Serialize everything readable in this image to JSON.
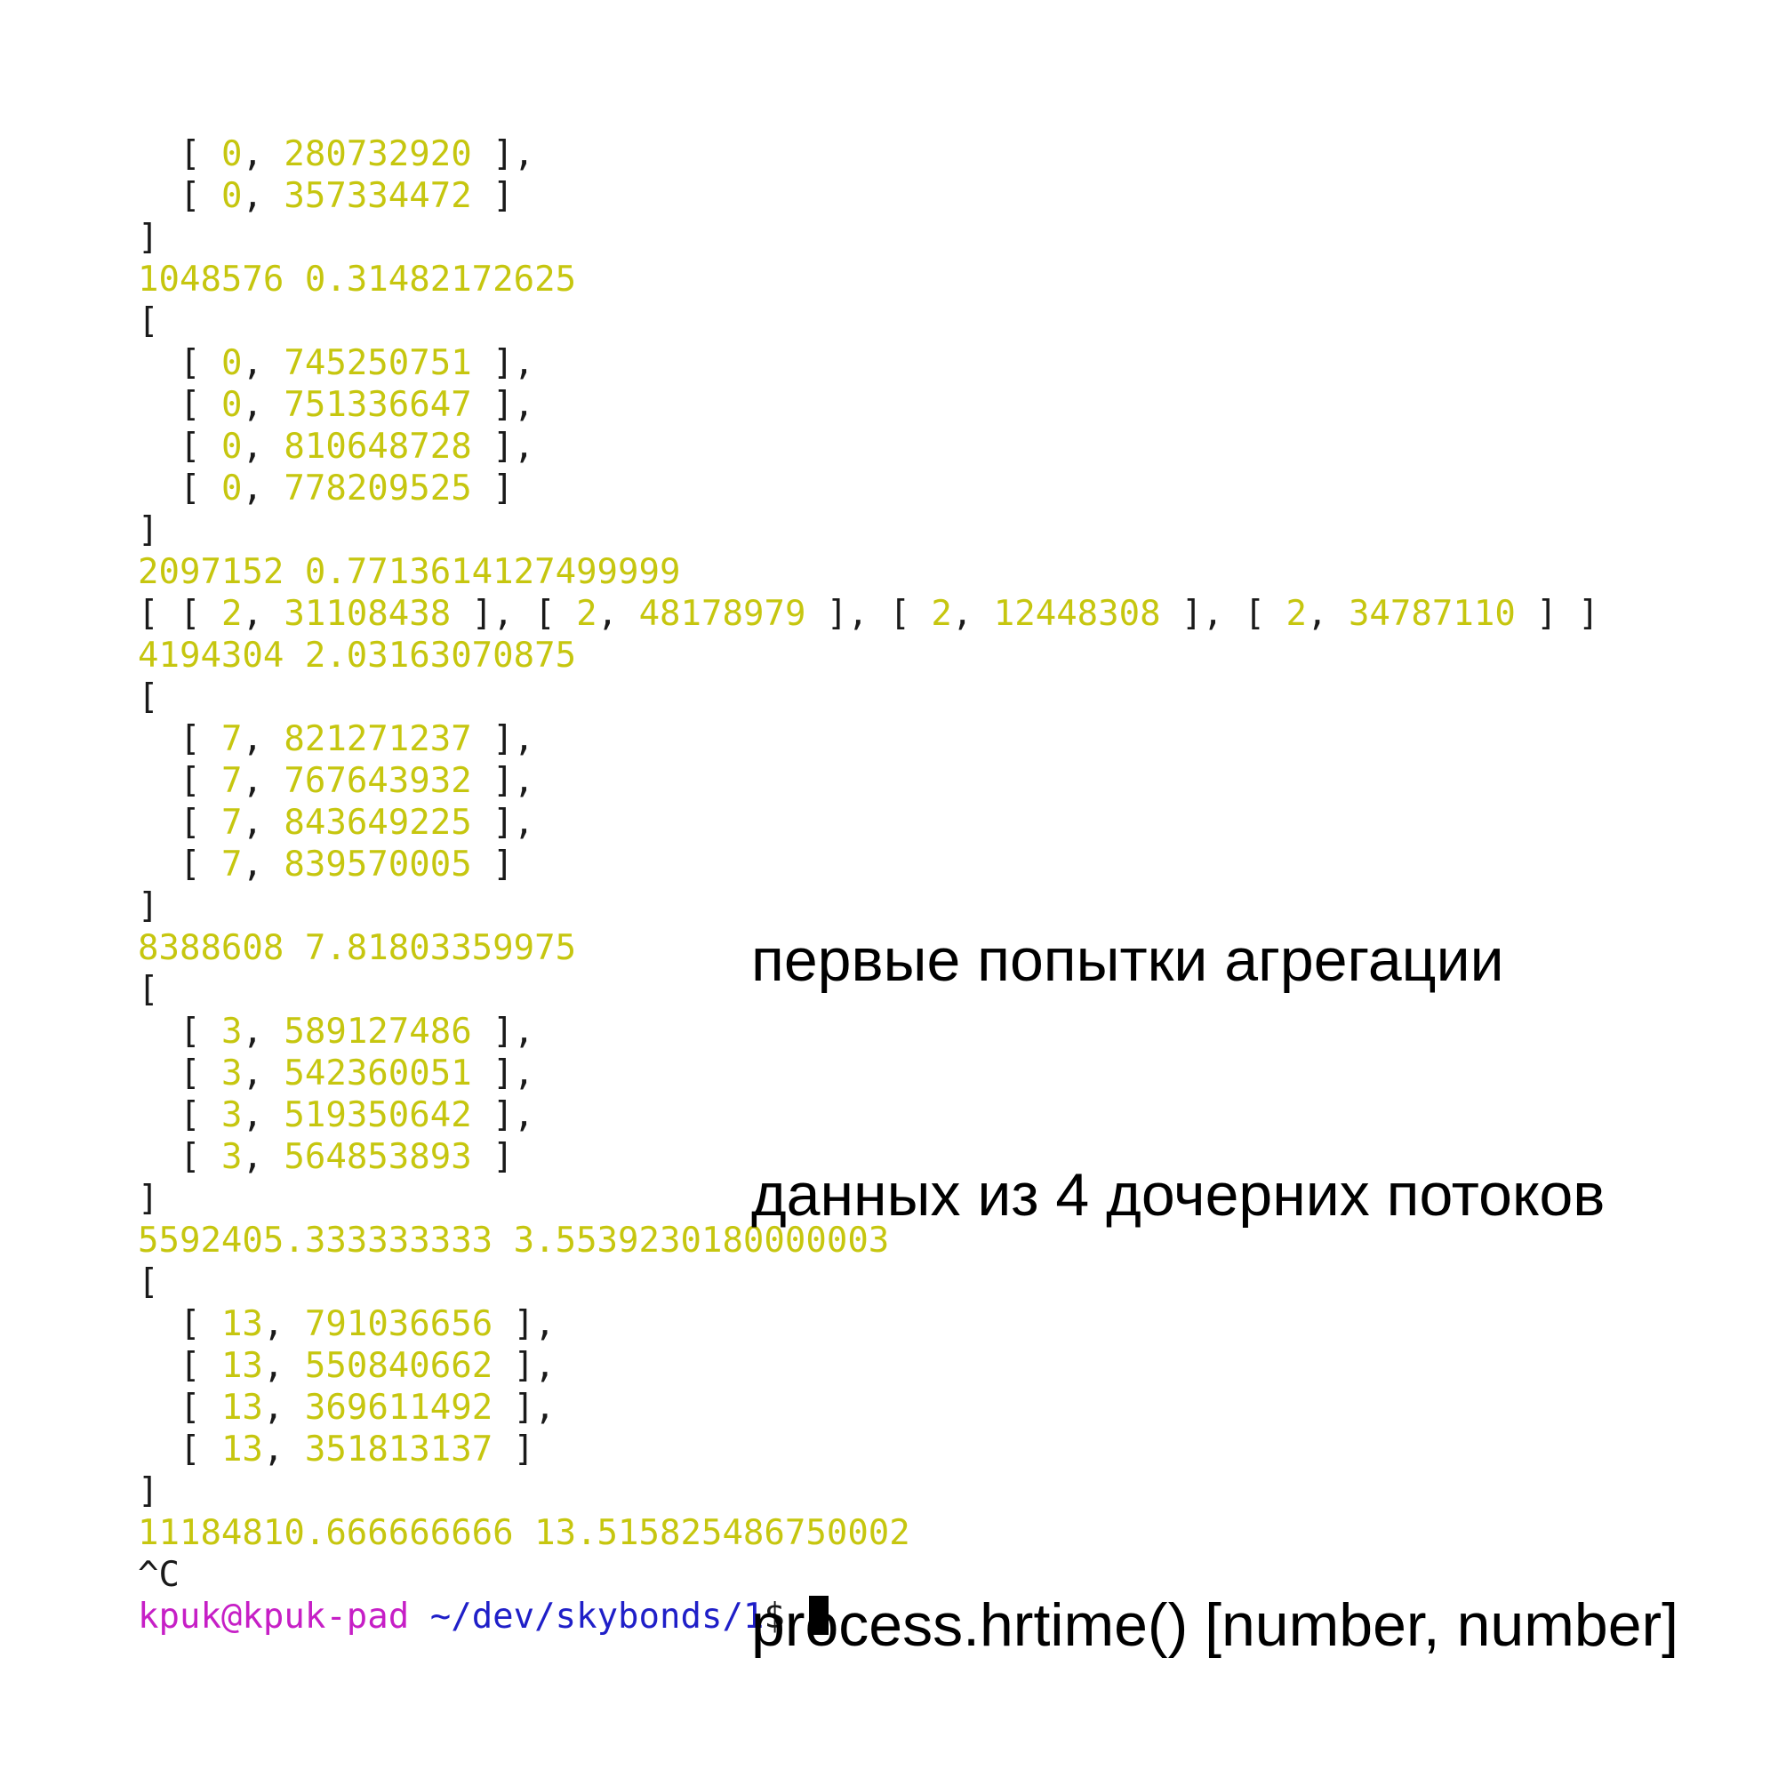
{
  "terminal": {
    "lines": [
      {
        "indent": "  ",
        "open": "[ ",
        "a": "0",
        "sep": ", ",
        "b": "280732920",
        "close": " ],"
      },
      {
        "indent": "  ",
        "open": "[ ",
        "a": "0",
        "sep": ", ",
        "b": "357334472",
        "close": " ]"
      },
      {
        "text": "]",
        "kind": "plain"
      },
      {
        "text": "1048576 0.31482172625",
        "kind": "num"
      },
      {
        "text": "[",
        "kind": "plain"
      },
      {
        "indent": "  ",
        "open": "[ ",
        "a": "0",
        "sep": ", ",
        "b": "745250751",
        "close": " ],"
      },
      {
        "indent": "  ",
        "open": "[ ",
        "a": "0",
        "sep": ", ",
        "b": "751336647",
        "close": " ],"
      },
      {
        "indent": "  ",
        "open": "[ ",
        "a": "0",
        "sep": ", ",
        "b": "810648728",
        "close": " ],"
      },
      {
        "indent": "  ",
        "open": "[ ",
        "a": "0",
        "sep": ", ",
        "b": "778209525",
        "close": " ]"
      },
      {
        "text": "]",
        "kind": "plain"
      },
      {
        "text": "2097152 0.7713614127499999",
        "kind": "num"
      },
      {
        "inline": [
          [
            "2",
            "31108438"
          ],
          [
            "2",
            "48178979"
          ],
          [
            "2",
            "12448308"
          ],
          [
            "2",
            "34787110"
          ]
        ]
      },
      {
        "text": "4194304 2.03163070875",
        "kind": "num"
      },
      {
        "text": "[",
        "kind": "plain"
      },
      {
        "indent": "  ",
        "open": "[ ",
        "a": "7",
        "sep": ", ",
        "b": "821271237",
        "close": " ],"
      },
      {
        "indent": "  ",
        "open": "[ ",
        "a": "7",
        "sep": ", ",
        "b": "767643932",
        "close": " ],"
      },
      {
        "indent": "  ",
        "open": "[ ",
        "a": "7",
        "sep": ", ",
        "b": "843649225",
        "close": " ],"
      },
      {
        "indent": "  ",
        "open": "[ ",
        "a": "7",
        "sep": ", ",
        "b": "839570005",
        "close": " ]"
      },
      {
        "text": "]",
        "kind": "plain"
      },
      {
        "text": "8388608 7.81803359975",
        "kind": "num"
      },
      {
        "text": "[",
        "kind": "plain"
      },
      {
        "indent": "  ",
        "open": "[ ",
        "a": "3",
        "sep": ", ",
        "b": "589127486",
        "close": " ],"
      },
      {
        "indent": "  ",
        "open": "[ ",
        "a": "3",
        "sep": ", ",
        "b": "542360051",
        "close": " ],"
      },
      {
        "indent": "  ",
        "open": "[ ",
        "a": "3",
        "sep": ", ",
        "b": "519350642",
        "close": " ],"
      },
      {
        "indent": "  ",
        "open": "[ ",
        "a": "3",
        "sep": ", ",
        "b": "564853893",
        "close": " ]"
      },
      {
        "text": "]",
        "kind": "plain"
      },
      {
        "text": "5592405.333333333 3.5539230180000003",
        "kind": "num"
      },
      {
        "text": "[",
        "kind": "plain"
      },
      {
        "indent": "  ",
        "open": "[ ",
        "a": "13",
        "sep": ", ",
        "b": "791036656",
        "close": " ],"
      },
      {
        "indent": "  ",
        "open": "[ ",
        "a": "13",
        "sep": ", ",
        "b": "550840662",
        "close": " ],"
      },
      {
        "indent": "  ",
        "open": "[ ",
        "a": "13",
        "sep": ", ",
        "b": "369611492",
        "close": " ],"
      },
      {
        "indent": "  ",
        "open": "[ ",
        "a": "13",
        "sep": ", ",
        "b": "351813137",
        "close": " ]"
      },
      {
        "text": "]",
        "kind": "plain"
      },
      {
        "text": "11184810.666666666 13.515825486750002",
        "kind": "num"
      },
      {
        "text": "^C",
        "kind": "plain"
      }
    ],
    "prompt": {
      "user_host": "kpuk@kpuk-pad",
      "path": " ~/dev/skybonds/1",
      "symbol": "$ "
    }
  },
  "caption": {
    "line1": "первые попытки агрегации",
    "line2": "данных из 4 дочерних потоков",
    "line3": "process.hrtime() [number, number]"
  },
  "colors": {
    "numbers": "#c6c60f",
    "text": "#1a1a1a",
    "prompt_user": "#c61fc6",
    "prompt_path": "#1f1fc8"
  }
}
